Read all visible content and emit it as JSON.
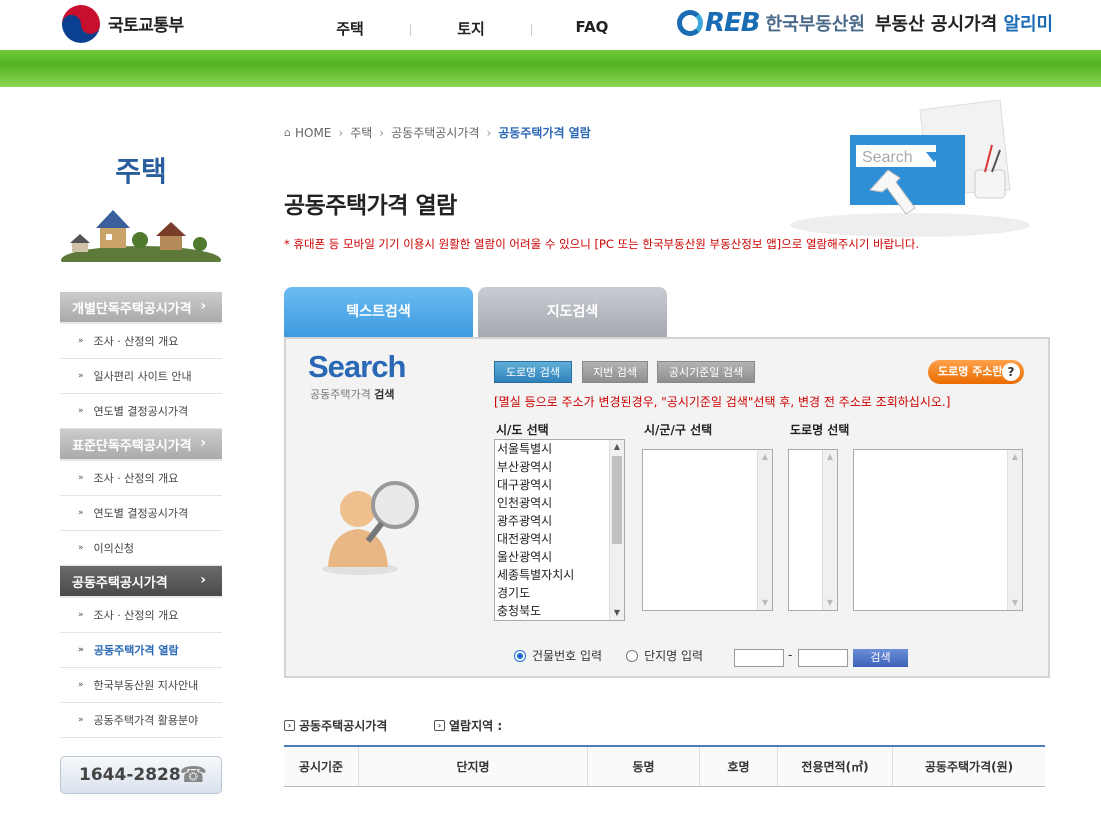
{
  "header": {
    "gov_name": "국토교통부",
    "gnb": [
      "주택",
      "토지",
      "FAQ"
    ],
    "reb_logo": "REB",
    "reb_kor": "한국부동산원",
    "slogan_a": "부동산 공시가격",
    "slogan_b": "알리미"
  },
  "lnb": {
    "title": "주택",
    "groups": [
      {
        "label": "개별단독주택공시가격",
        "items": [
          "조사 · 산정의 개요",
          "일사편리 사이트 안내",
          "연도별 결정공시가격"
        ]
      },
      {
        "label": "표준단독주택공시가격",
        "items": [
          "조사 · 산정의 개요",
          "연도별 결정공시가격",
          "이의신청"
        ]
      },
      {
        "label": "공동주택공시가격",
        "items": [
          "조사 · 산정의 개요",
          "공동주택가격 열람",
          "한국부동산원 지사안내",
          "공동주택가격 활용분야"
        ]
      }
    ],
    "phone": "1644-2828"
  },
  "breadcrumb": {
    "home": "HOME",
    "items": [
      "주택",
      "공동주택공시가격",
      "공동주택가격 열람"
    ]
  },
  "page_title": "공동주택가격 열람",
  "notice": "* 휴대폰 등 모바일 기기 이용시 원활한 열람이 어려울 수 있으니 [PC 또는 한국부동산원 부동산정보 앱]으로 열람해주시기 바랍니다.",
  "illus_text": "Search",
  "tabs": [
    "텍스트검색",
    "지도검색"
  ],
  "panel": {
    "logo": "Search",
    "sub_a": "공동주택가격",
    "sub_b": "검색",
    "buttons": [
      "도로명 검색",
      "지번 검색",
      "공시기준일 검색"
    ],
    "road_btn": "도로명 주소란",
    "road_q": "?",
    "warning": "[멸실 등으로 주소가 변경된경우, \"공시기준일 검색\"선택 후, 변경 전 주소로 조회하십시오.]",
    "labels": [
      "시/도 선택",
      "시/군/구 선택",
      "도로명 선택"
    ],
    "sido": [
      "서울특별시",
      "부산광역시",
      "대구광역시",
      "인천광역시",
      "광주광역시",
      "대전광역시",
      "울산광역시",
      "세종특별자치시",
      "경기도",
      "충청북도"
    ],
    "radio1": "건물번호 입력",
    "radio2": "단지명 입력",
    "dash": "-",
    "go": "검색"
  },
  "result": {
    "sect1": "공동주택공시가격",
    "sect2": "열람지역 :",
    "columns": [
      "공시기준",
      "단지명",
      "동명",
      "호명",
      "전용면적(㎡)",
      "공동주택가격(원)"
    ]
  }
}
